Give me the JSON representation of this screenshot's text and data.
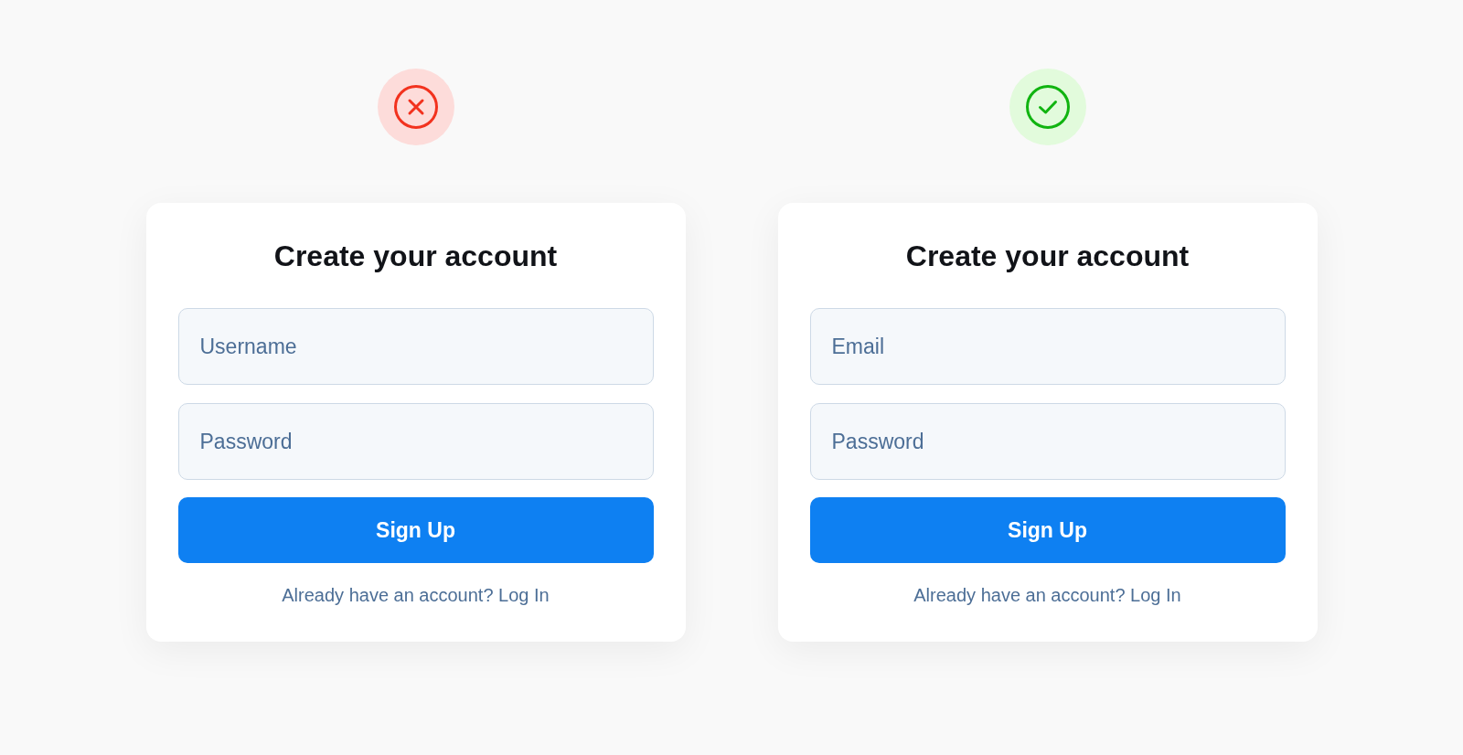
{
  "examples": [
    {
      "verdict": {
        "kind": "wrong"
      },
      "form": {
        "title": "Create your account",
        "fields": [
          {
            "placeholder": "Username"
          },
          {
            "placeholder": "Password"
          }
        ],
        "submit_button": "Sign Up",
        "footer": {
          "text": "Already have an account?",
          "link": "Log In"
        }
      }
    },
    {
      "verdict": {
        "kind": "right"
      },
      "form": {
        "title": "Create your account",
        "fields": [
          {
            "placeholder": "Email"
          },
          {
            "placeholder": "Password"
          }
        ],
        "submit_button": "Sign Up",
        "footer": {
          "text": "Already have an account?",
          "link": "Log In"
        }
      }
    }
  ]
}
